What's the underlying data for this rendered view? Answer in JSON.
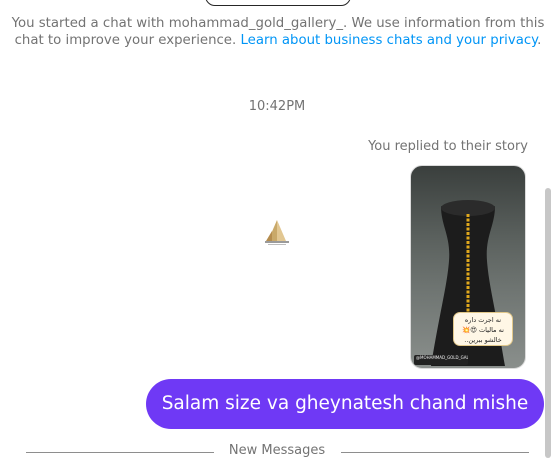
{
  "info": {
    "text": "You started a chat with mohammad_gold_gallery_. We use information from this chat to improve your experience.",
    "link": "Learn about business chats and your privacy",
    "suffix": "."
  },
  "timestamp": "10:42PM",
  "story_reply": {
    "label": "You replied to their story",
    "sticker_line1": "نه اجرت داره",
    "sticker_line2": "نه مالیات 😍💥",
    "sticker_line3": "خالشو ببرین..",
    "handle": "@MOHAMMAD_GOLD_GALLERY_"
  },
  "message": {
    "text": "Salam size va gheynatesh chand mishe"
  },
  "divider": {
    "label": "New Messages"
  },
  "colors": {
    "bubble": "#6f39f5",
    "link": "#0095f6",
    "chain": "#e0a81c"
  }
}
